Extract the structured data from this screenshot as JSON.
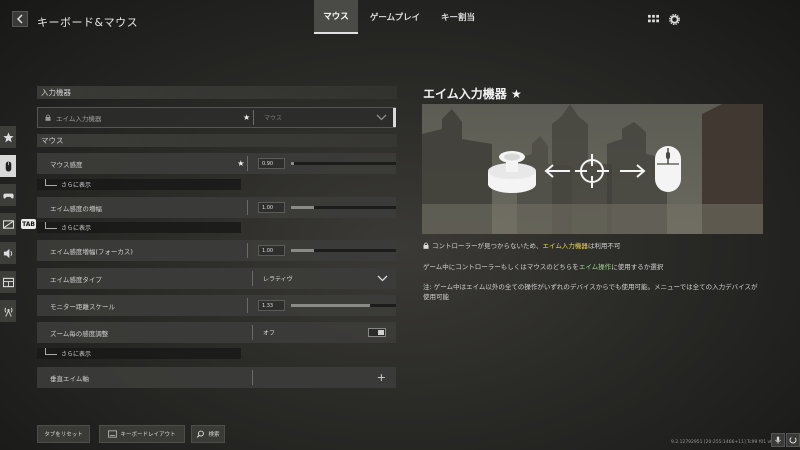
{
  "header": {
    "title": "キーボード&マウス",
    "tabs": [
      {
        "label": "マウス",
        "active": true
      },
      {
        "label": "ゲームプレイ",
        "active": false
      },
      {
        "label": "キー割当",
        "active": false
      }
    ],
    "icons": [
      "grid-icon",
      "gear-icon"
    ]
  },
  "rail": {
    "items": [
      "star-icon",
      "mouse-icon",
      "gamepad-icon",
      "display-icon",
      "speaker-icon",
      "interface-icon",
      "network-icon"
    ],
    "active": "mouse-icon",
    "tab_key": "TAB"
  },
  "settings": {
    "section_input": "入力機器",
    "input_device": {
      "label": "エイム入力機器",
      "value": "マウス",
      "starred": true,
      "locked": true
    },
    "section_mouse": "マウス",
    "rows": [
      {
        "label": "マウス感度",
        "starred": true,
        "type": "slider",
        "value": "0.90",
        "fill_fraction": 0.03
      },
      {
        "label": "エイム感度の増幅",
        "starred": false,
        "type": "slider",
        "value": "1.00",
        "fill_fraction": 0.22
      },
      {
        "label": "エイム感度増幅(フォーカス)",
        "starred": false,
        "type": "slider",
        "value": "1.00",
        "fill_fraction": 0.22
      },
      {
        "label": "エイム感度タイプ",
        "starred": false,
        "type": "dropdown",
        "value": "レラティヴ"
      },
      {
        "label": "モニター距離スケール",
        "starred": false,
        "type": "slider",
        "value": "1.33",
        "fill_fraction": 0.75
      },
      {
        "label": "ズーム毎の感度調整",
        "starred": false,
        "type": "toggle",
        "value": "オフ"
      },
      {
        "label": "垂直エイム軸",
        "starred": false,
        "type": "expand",
        "value": ""
      }
    ],
    "show_more": "さらに表示",
    "star_glyph": "★"
  },
  "detail": {
    "title": "エイム入力機器 ★",
    "desc1_pre": "コントローラーが見つからないため、",
    "desc1_hl": "エイム入力機器",
    "desc1_post": "は利用不可",
    "desc2_pre": "ゲーム中にコントローラーもしくはマウスのどちらを",
    "desc2_hl": "エイム操作",
    "desc2_post": "に使用するか選択",
    "desc3": "注: ゲーム中はエイム以外の全ての操作がいずれのデバイスからでも使用可能。メニューでは全ての入力デバイスが使用可能",
    "highlight_color": "#ecd94e"
  },
  "footer": {
    "reset": "タブをリセット",
    "keyboard_layout": "キーボードレイアウト",
    "search": "検索",
    "version": "9.2.12792951 [20:255:1466+11] Tc99 f01 vt 00a0"
  }
}
